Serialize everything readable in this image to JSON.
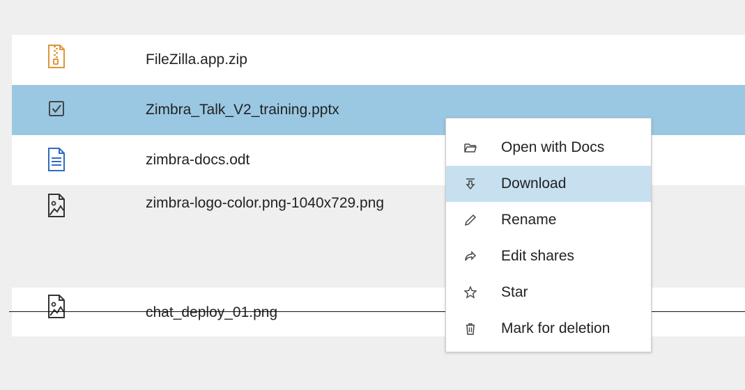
{
  "files": [
    {
      "name": "FileZilla.app.zip",
      "icon": "zip-file-icon",
      "selected": false
    },
    {
      "name": "Zimbra_Talk_V2_training.pptx",
      "icon": "checkbox-checked-icon",
      "selected": true
    },
    {
      "name": "zimbra-docs.odt",
      "icon": "document-file-icon",
      "selected": false
    },
    {
      "name": "zimbra-logo-color.png-1040x729.png",
      "icon": "image-file-icon",
      "selected": false
    },
    {
      "name": "chat_deploy_01.png",
      "icon": "image-file-icon",
      "selected": false,
      "marked_for_deletion": true
    }
  ],
  "context_menu": {
    "items": [
      {
        "label": "Open with Docs",
        "icon": "folder-open-icon"
      },
      {
        "label": "Download",
        "icon": "download-icon",
        "highlighted": true
      },
      {
        "label": "Rename",
        "icon": "pencil-icon"
      },
      {
        "label": "Edit shares",
        "icon": "share-icon"
      },
      {
        "label": "Star",
        "icon": "star-icon"
      },
      {
        "label": "Mark for deletion",
        "icon": "trash-icon"
      }
    ]
  },
  "colors": {
    "selected_row": "#9ac8e3",
    "highlighted_menu_item": "#c6e0f0",
    "zip_icon": "#e0953a",
    "doc_icon": "#2f6bc0"
  }
}
